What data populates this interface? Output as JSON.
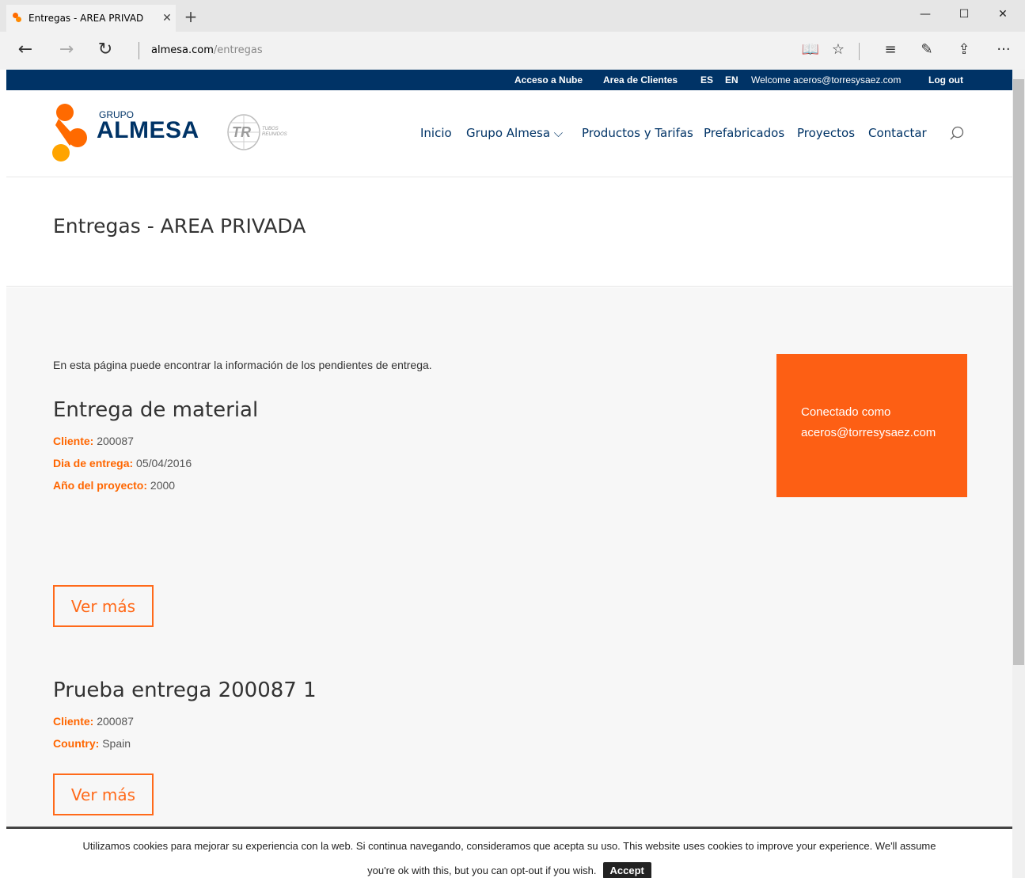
{
  "browser": {
    "tab_title": "Entregas - AREA PRIVAD",
    "tab_close": "✕",
    "new_tab": "+",
    "win_min": "—",
    "win_max": "☐",
    "win_close": "✕",
    "back": "←",
    "forward": "→",
    "refresh": "↻",
    "url_host": "almesa.com",
    "url_path": "/entregas",
    "reading_view": "📖",
    "favorite": "☆",
    "hub": "≡",
    "web_note": "✎",
    "share": "⇪",
    "more": "···"
  },
  "topbar": {
    "acceso_nube": "Acceso a Nube",
    "area_clientes": "Area de Clientes",
    "lang_es": "ES",
    "lang_en": "EN",
    "welcome": "Welcome aceros@torresysaez.com",
    "logout": "Log out"
  },
  "header": {
    "logo_small": "GRUPO",
    "logo_big": "ALMESA",
    "tr_small": "TUBOS REUNIDOS",
    "nav": [
      "Inicio",
      "Grupo Almesa ⌵",
      "Productos y Tarifas",
      "Prefabricados",
      "Proyectos",
      "Contactar"
    ]
  },
  "page": {
    "title": "Entregas - AREA PRIVADA",
    "intro": "En esta página puede encontrar la información de los pendientes de entrega."
  },
  "entries": [
    {
      "title": "Entrega de material",
      "fields": [
        {
          "label": "Cliente:",
          "value": " 200087"
        },
        {
          "label": "Dia de entrega:",
          "value": " 05/04/2016"
        },
        {
          "label": "Año del proyecto:",
          "value": " 2000"
        }
      ],
      "button": "Ver más"
    },
    {
      "title": "Prueba entrega 200087 1",
      "fields": [
        {
          "label": "Cliente:",
          "value": " 200087"
        },
        {
          "label": "Country:",
          "value": " Spain"
        }
      ],
      "button": "Ver más"
    }
  ],
  "sidebox": {
    "line1": "Conectado como",
    "line2": "aceros@torresysaez.com"
  },
  "cookie": {
    "line1": "Utilizamos cookies para mejorar su experiencia con la web. Si continua navegando, consideramos que acepta su uso. This website uses cookies to improve your experience. We'll assume",
    "line2": "you're ok with this, but you can opt-out if you wish.",
    "accept": "Accept"
  },
  "colors": {
    "brand_navy": "#003366",
    "brand_orange": "#ff6600",
    "sidebox_orange": "#fd5f14"
  }
}
